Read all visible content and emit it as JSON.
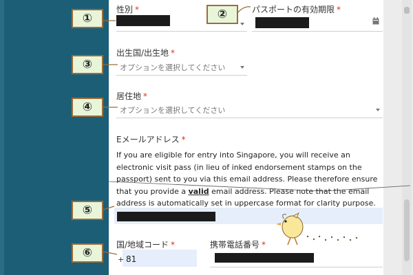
{
  "form": {
    "gender_label": "性別",
    "passport_expiry_label": "パスポートの有効期限",
    "birth_country_label": "出生国/出生地",
    "birth_country_placeholder": "オプションを選択してください",
    "residence_label": "居住地",
    "residence_placeholder": "オプションを選択してください",
    "email_label": "Eメールアドレス",
    "email_note_part1": "If you are eligible for entry into Singapore, you will receive an electronic visit pass (in lieu of inked endorsement stamps on the passport) sent to you via this email address. Please therefore ensure that you provide a ",
    "email_note_bold": "valid",
    "email_note_part2": " email address. Please note that the email address is automatically set in uppercase format for clarity purpose.",
    "country_code_label": "国/地域コード",
    "country_code_prefix": "+",
    "country_code_value": "81",
    "mobile_label": "携帯電話番号",
    "required_mark": "*"
  },
  "annotations": [
    "①",
    "②",
    "③",
    "④",
    "⑤",
    "⑥"
  ],
  "colors": {
    "sidebar": "#1d5e77",
    "badge_fill": "#e9f5d9",
    "badge_border": "#9a6d3c",
    "required": "#d9341a",
    "input_fill": "#e6eefb"
  }
}
